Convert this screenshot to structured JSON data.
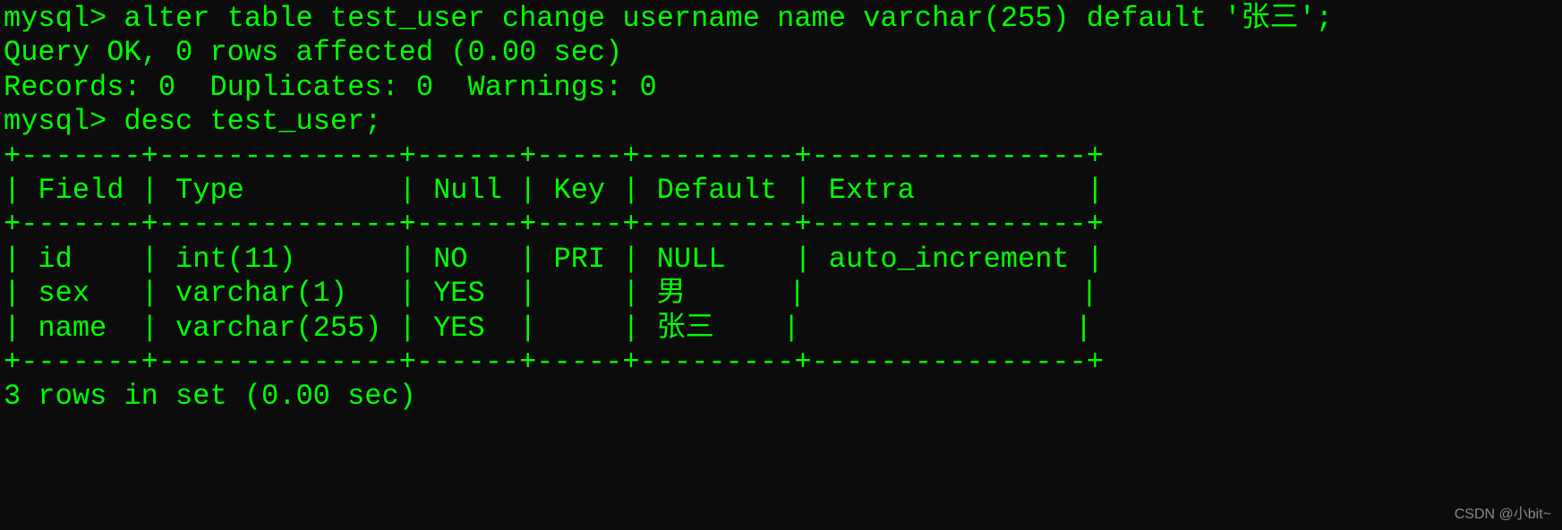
{
  "lines": {
    "line1_prompt": "mysql> ",
    "line1_command": "alter table test_user change username name varchar(255) default '张三';",
    "line2": "Query OK, 0 rows affected (0.00 sec)",
    "line3": "Records: 0  Duplicates: 0  Warnings: 0",
    "line4": "",
    "line5_prompt": "mysql> ",
    "line5_command": "desc test_user;"
  },
  "table": {
    "border_top": "+-------+--------------+------+-----+---------+----------------+",
    "header_row": "| Field | Type         | Null | Key | Default | Extra          |",
    "border_mid": "+-------+--------------+------+-----+---------+----------------+",
    "row1": "| id    | int(11)      | NO   | PRI | NULL    | auto_increment |",
    "row2": "| sex   | varchar(1)   | YES  |     | 男      |                |",
    "row3": "| name  | varchar(255) | YES  |     | 张三    |                |",
    "border_bottom": "+-------+--------------+------+-----+---------+----------------+"
  },
  "footer": "3 rows in set (0.00 sec)",
  "watermark": "CSDN @小bit~",
  "chart_data": {
    "type": "table",
    "title": "desc test_user",
    "columns": [
      "Field",
      "Type",
      "Null",
      "Key",
      "Default",
      "Extra"
    ],
    "rows": [
      [
        "id",
        "int(11)",
        "NO",
        "PRI",
        "NULL",
        "auto_increment"
      ],
      [
        "sex",
        "varchar(1)",
        "YES",
        "",
        "男",
        ""
      ],
      [
        "name",
        "varchar(255)",
        "YES",
        "",
        "张三",
        ""
      ]
    ]
  }
}
